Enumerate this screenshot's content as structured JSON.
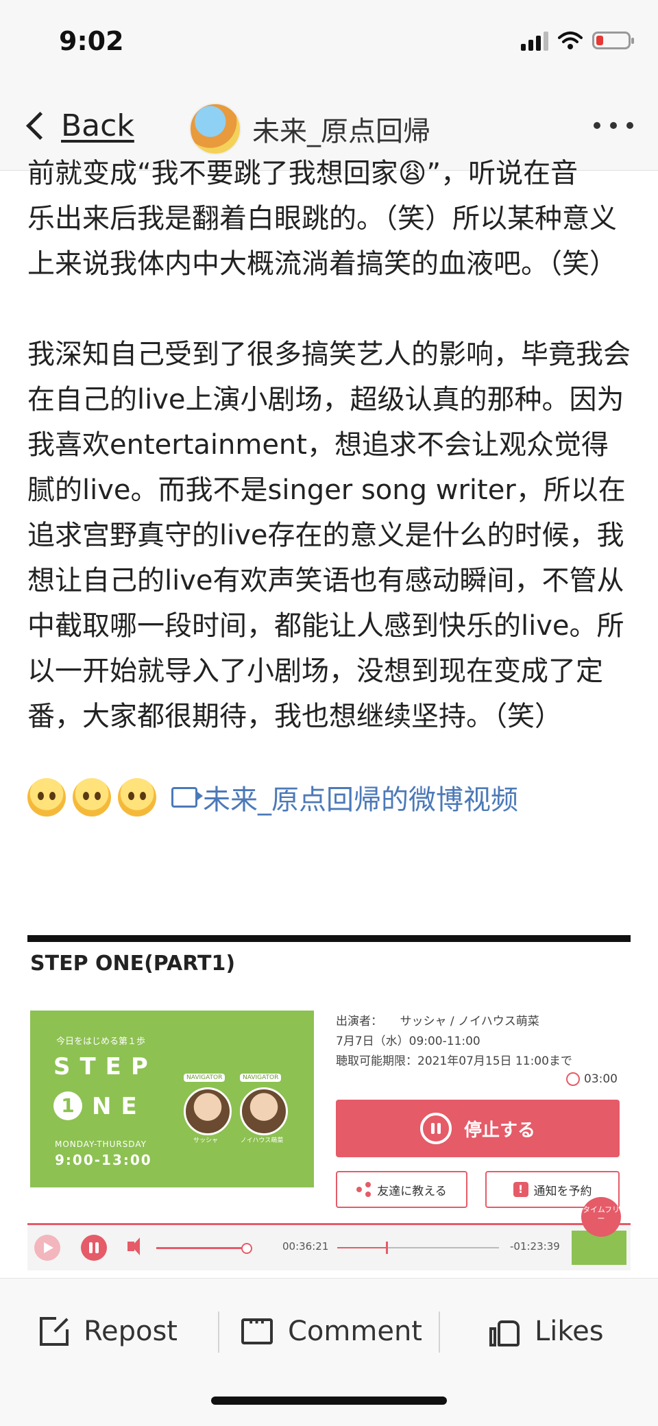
{
  "status_bar": {
    "time": "9:02"
  },
  "nav": {
    "back_label": "Back",
    "title": "未来_原点回帰"
  },
  "post": {
    "top_fragment": "前就变成“我不要跳了我想回家😩”，听说在音",
    "paragraph_1": "乐出来后我是翻着白眼跳的。（笑）所以某种意义上来说我体内中大概流淌着搞笑的血液吧。（笑）",
    "paragraph_2": "我深知自己受到了很多搞笑艺人的影响，毕竟我会在自己的live上演小剧场，超级认真的那种。因为我喜欢entertainment，想追求不会让观众觉得腻的live。而我不是singer song writer，所以在追求宫野真守的live存在的意义是什么的时候，我想让自己的live有欢声笑语也有感动瞬间，不管从中截取哪一段时间，都能让人感到快乐的live。所以一开始就导入了小剧场，没想到现在变成了定番，大家都很期待，我也想继续坚持。（笑）",
    "video_link": "未来_原点回帰的微博视频"
  },
  "player": {
    "title": "STEP ONE(PART1)",
    "banner": {
      "subtitle": "今日をはじめる第１歩",
      "step": "STEP",
      "one_badge": "1",
      "ne": "NE",
      "days": "MONDAY-THURSDAY",
      "hours": "9:00-13:00",
      "navigator_tag": "NAVIGATOR",
      "navigator_1": "サッシャ",
      "navigator_2": "ノイハウス萌菜"
    },
    "cast_line": "出演者：　　サッシャ / ノイハウス萌菜",
    "date_line": "7月7日（水）09:00-11:00",
    "deadline_line": "聴取可能期限：2021年07月15日 11:00まで",
    "timer": "03:00",
    "stop_label": "停止する",
    "share_label": "友達に教える",
    "notify_label": "通知を予約",
    "timefree_label": "タイムフリー",
    "elapsed": "00:36:21",
    "remaining": "-01:23:39",
    "seek_progress": 0.3,
    "volume_level": 0.8
  },
  "toolbar": {
    "repost": "Repost",
    "comment": "Comment",
    "likes": "Likes"
  }
}
